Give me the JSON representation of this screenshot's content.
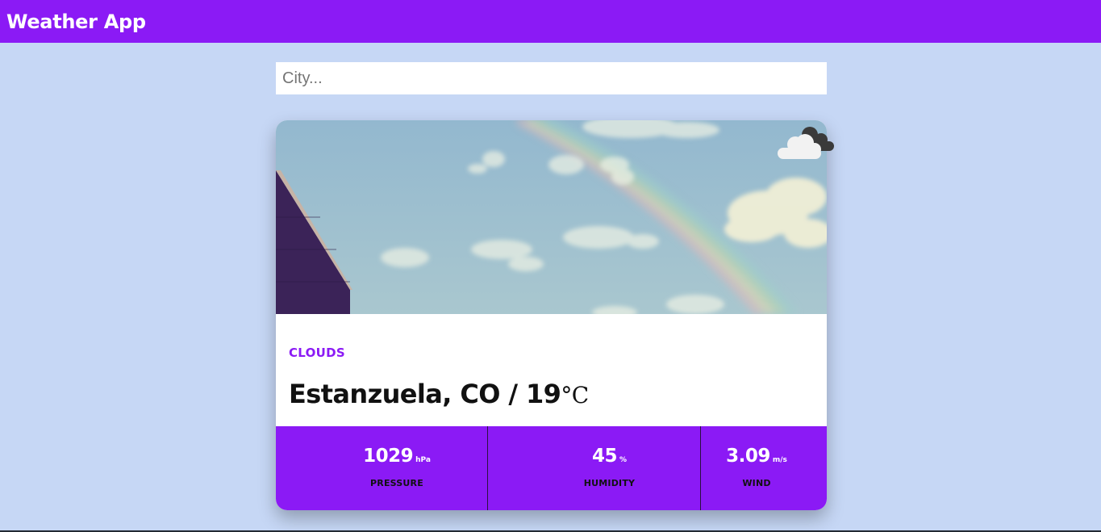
{
  "header": {
    "title": "Weather App",
    "color": "#8b1af5"
  },
  "search": {
    "placeholder": "City...",
    "value": ""
  },
  "weather": {
    "condition": "CLOUDS",
    "icon": "clouds-icon",
    "city": "Estanzuela, CO",
    "separator": " / ",
    "temperature": "19",
    "temperature_unit": "°C"
  },
  "stats": [
    {
      "value": "1029",
      "unit": "hPa",
      "label": "PRESSURE"
    },
    {
      "value": "45",
      "unit": "%",
      "label": "HUMIDITY"
    },
    {
      "value": "3.09",
      "unit": "m/s",
      "label": "WIND"
    }
  ]
}
